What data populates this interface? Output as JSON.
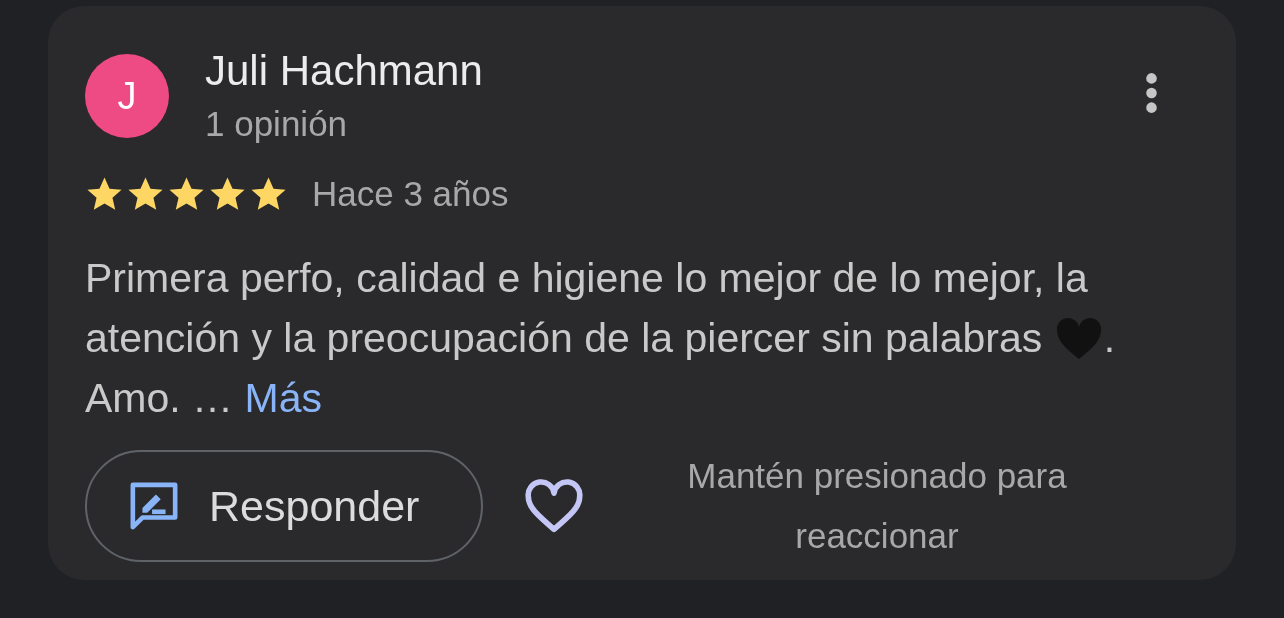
{
  "review": {
    "avatar_letter": "J",
    "author": "Juli Hachmann",
    "author_meta": "1 opinión",
    "stars": 5,
    "time": "Hace 3 años",
    "body_start": "Primera perfo, calidad e higiene lo mejor de lo mejor, la atención y la preocupación de la piercer sin palabras",
    "body_end": ". Amo. …",
    "more_link": "Más",
    "reply_button": "Responder",
    "liked": false,
    "reaction_hint": "Mantén presionado para reaccionar"
  }
}
